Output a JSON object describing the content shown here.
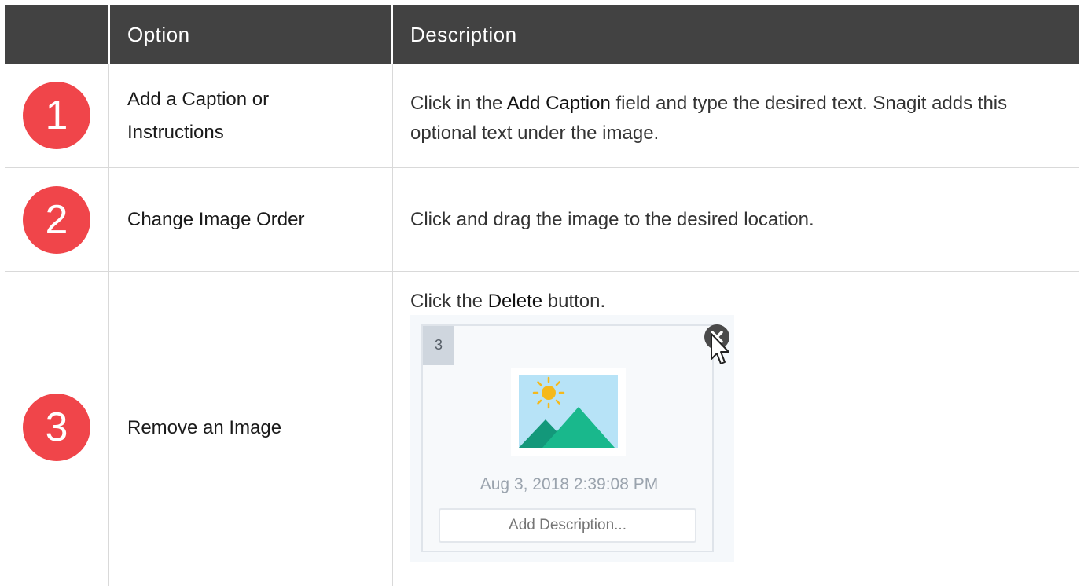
{
  "header": {
    "col_option": "Option",
    "col_description": "Description"
  },
  "rows": [
    {
      "badge": "1",
      "option_line1": "Add a Caption or",
      "option_line2": "Instructions",
      "desc_pre": "Click in the ",
      "desc_bold": "Add Caption",
      "desc_post": " field and type the desired text. Snagit adds this optional text under the image."
    },
    {
      "badge": "2",
      "option": "Change Image Order",
      "desc": "Click and drag the image to the desired location."
    },
    {
      "badge": "3",
      "option": "Remove an Image",
      "desc_pre": "Click the ",
      "desc_bold": "Delete",
      "desc_post": " button."
    }
  ],
  "thumbnail": {
    "number": "3",
    "date": "Aug 3, 2018 2:39:08 PM",
    "description_placeholder": "Add Description...",
    "icons": [
      "close-icon",
      "sun-icon",
      "mountain-icon",
      "pointer-cursor-icon"
    ]
  },
  "colors": {
    "header_bg": "#424242",
    "badge_red": "#f0454a",
    "border": "#d9d9d9",
    "image_sky": "#b7e3f7",
    "sun": "#f5b91b",
    "mountain_dark": "#13987a",
    "mountain_light": "#19b88c"
  }
}
